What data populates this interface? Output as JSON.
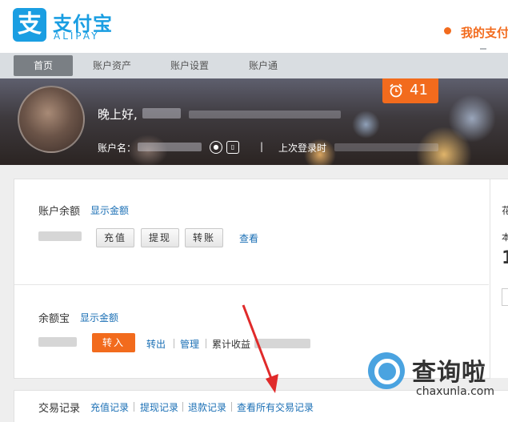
{
  "header": {
    "logo_mark": "支",
    "logo_cn": "支付宝",
    "logo_en": "ALIPAY",
    "my_link": "我的支付"
  },
  "nav": {
    "items": [
      {
        "label": "首页",
        "active": true
      },
      {
        "label": "账户资产",
        "active": false
      },
      {
        "label": "账户设置",
        "active": false
      },
      {
        "label": "账户通",
        "active": false
      }
    ]
  },
  "banner": {
    "greeting": "晚上好,",
    "account_label": "账户名：",
    "separator": "|",
    "last_login_label": "上次登录时",
    "alarm_count": "41"
  },
  "balance": {
    "label": "账户余额",
    "show_amount": "显示金额",
    "recharge": "充值",
    "withdraw": "提现",
    "transfer": "转账",
    "view": "查看"
  },
  "yuebao": {
    "label": "余额宝",
    "show_amount": "显示金额",
    "transfer_in": "转入",
    "transfer_out": "转出",
    "manage": "管理",
    "cumulative": "累计收益"
  },
  "transactions": {
    "label": "交易记录",
    "links": [
      "充值记录",
      "提现记录",
      "退款记录",
      "查看所有交易记录"
    ]
  },
  "side": {
    "a": "花",
    "b": "本",
    "c": "1"
  },
  "watermark": {
    "cn": "查询啦",
    "en": "chaxunla.com"
  },
  "colors": {
    "brand_blue": "#1a9ee2",
    "accent_orange": "#f26b1d",
    "link_blue": "#1a6fb5",
    "annotation_red": "#e02a2a"
  }
}
